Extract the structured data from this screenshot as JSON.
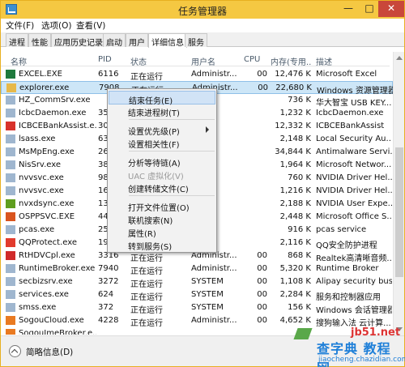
{
  "window": {
    "title": "任务管理器",
    "controls": {
      "minimize": "—",
      "maximize": "□",
      "close": "✕"
    }
  },
  "menu": [
    "文件(F)",
    "选项(O)",
    "查看(V)"
  ],
  "tabs": [
    "进程",
    "性能",
    "应用历史记录",
    "启动",
    "用户",
    "详细信息",
    "服务"
  ],
  "active_tab": "详细信息",
  "columns": [
    "名称",
    "PID",
    "状态",
    "用户名",
    "CPU",
    "内存(专用...",
    "描述"
  ],
  "processes": [
    {
      "name": "EXCEL.EXE",
      "pid": "6116",
      "status": "正在运行",
      "user": "Administr...",
      "cpu": "00",
      "mem": "12,476 K",
      "desc": "Microsoft Excel",
      "icon": "excel-icon"
    },
    {
      "name": "explorer.exe",
      "pid": "7908",
      "status": "正在运行",
      "user": "Administr...",
      "cpu": "00",
      "mem": "22,680 K",
      "desc": "Windows 资源管理器",
      "icon": "folder-icon",
      "selected": true
    },
    {
      "name": "HZ_CommSrv.exe",
      "pid": "",
      "status": "",
      "user": "",
      "cpu": "",
      "mem": "736 K",
      "desc": "华大智宝 USB KEY...",
      "icon": "generic-app-icon"
    },
    {
      "name": "IcbcDaemon.exe",
      "pid": "35",
      "status": "",
      "user": "",
      "cpu": "",
      "mem": "1,232 K",
      "desc": "IcbcDaemon.exe",
      "icon": "generic-app-icon"
    },
    {
      "name": "ICBCEBankAssist.e...",
      "pid": "30",
      "status": "",
      "user": "",
      "cpu": "",
      "mem": "12,332 K",
      "desc": "ICBCEBankAssist",
      "icon": "icbc-icon"
    },
    {
      "name": "lsass.exe",
      "pid": "63",
      "status": "",
      "user": "",
      "cpu": "",
      "mem": "2,148 K",
      "desc": "Local Security Au...",
      "icon": "generic-app-icon"
    },
    {
      "name": "MsMpEng.exe",
      "pid": "26",
      "status": "",
      "user": "",
      "cpu": "",
      "mem": "34,844 K",
      "desc": "Antimalware Servi...",
      "icon": "generic-app-icon"
    },
    {
      "name": "NisSrv.exe",
      "pid": "38",
      "status": "",
      "user": "",
      "cpu": "",
      "mem": "1,964 K",
      "desc": "Microsoft Networ...",
      "icon": "generic-app-icon"
    },
    {
      "name": "nvvsvc.exe",
      "pid": "98",
      "status": "",
      "user": "",
      "cpu": "",
      "mem": "760 K",
      "desc": "NVIDIA Driver Hel...",
      "icon": "generic-app-icon"
    },
    {
      "name": "nvvsvc.exe",
      "pid": "16",
      "status": "",
      "user": "",
      "cpu": "",
      "mem": "1,216 K",
      "desc": "NVIDIA Driver Hel...",
      "icon": "generic-app-icon"
    },
    {
      "name": "nvxdsync.exe",
      "pid": "13",
      "status": "",
      "user": "",
      "cpu": "",
      "mem": "2,188 K",
      "desc": "NVIDIA User Expe...",
      "icon": "nvidia-icon"
    },
    {
      "name": "OSPPSVC.EXE",
      "pid": "44",
      "status": "",
      "user": "",
      "cpu": "",
      "mem": "2,448 K",
      "desc": "Microsoft Office S...",
      "icon": "office-icon"
    },
    {
      "name": "pcas.exe",
      "pid": "25",
      "status": "",
      "user": "",
      "cpu": "",
      "mem": "916 K",
      "desc": "pcas service",
      "icon": "generic-app-icon"
    },
    {
      "name": "QQProtect.exe",
      "pid": "19",
      "status": "",
      "user": "",
      "cpu": "",
      "mem": "2,116 K",
      "desc": "QQ安全防护进程",
      "icon": "qq-icon"
    },
    {
      "name": "RtHDVCpl.exe",
      "pid": "3316",
      "status": "正在运行",
      "user": "Administr...",
      "cpu": "00",
      "mem": "868 K",
      "desc": "Realtek高清晰音频...",
      "icon": "speaker-icon"
    },
    {
      "name": "RuntimeBroker.exe",
      "pid": "7940",
      "status": "正在运行",
      "user": "Administr...",
      "cpu": "00",
      "mem": "5,320 K",
      "desc": "Runtime Broker",
      "icon": "generic-app-icon"
    },
    {
      "name": "secbizsrv.exe",
      "pid": "3272",
      "status": "正在运行",
      "user": "SYSTEM",
      "cpu": "00",
      "mem": "1,108 K",
      "desc": "Alipay security bus...",
      "icon": "generic-app-icon"
    },
    {
      "name": "services.exe",
      "pid": "624",
      "status": "正在运行",
      "user": "SYSTEM",
      "cpu": "00",
      "mem": "2,284 K",
      "desc": "服务和控制器应用",
      "icon": "generic-app-icon"
    },
    {
      "name": "smss.exe",
      "pid": "372",
      "status": "正在运行",
      "user": "SYSTEM",
      "cpu": "00",
      "mem": "156 K",
      "desc": "Windows 会话管理器",
      "icon": "generic-app-icon"
    },
    {
      "name": "SogouCloud.exe",
      "pid": "4228",
      "status": "正在运行",
      "user": "Administr...",
      "cpu": "00",
      "mem": "4,652 K",
      "desc": "搜狗输入法 云计算...",
      "icon": "sogou-icon"
    },
    {
      "name": "SogouImeBroker.e...",
      "pid": "",
      "status": "",
      "user": "",
      "cpu": "",
      "mem": "",
      "desc": "",
      "icon": "sogou-icon"
    }
  ],
  "context_menu": [
    {
      "label": "结束任务(E)",
      "hover": true
    },
    {
      "label": "结束进程树(T)"
    },
    {
      "sep": true
    },
    {
      "label": "设置优先级(P)",
      "submenu": true
    },
    {
      "label": "设置相关性(F)"
    },
    {
      "sep": true
    },
    {
      "label": "分析等待链(A)"
    },
    {
      "label": "UAC 虚拟化(V)",
      "disabled": true
    },
    {
      "label": "创建转储文件(C)"
    },
    {
      "sep": true
    },
    {
      "label": "打开文件位置(O)"
    },
    {
      "label": "联机搜索(N)"
    },
    {
      "label": "属性(R)"
    },
    {
      "label": "转到服务(S)"
    }
  ],
  "footer": {
    "label": "简略信息(D)"
  },
  "watermark": {
    "site": "jb51.net",
    "text": "查字典 教程网",
    "sub": "jiaocheng.chazidian.com"
  },
  "icon_colors": {
    "excel-icon": "#1f7a3d",
    "folder-icon": "#e7b94a",
    "generic-app-icon": "#9fb6cf",
    "icbc-icon": "#d8322b",
    "nvidia-icon": "#5f9e1f",
    "office-icon": "#d9541e",
    "qq-icon": "#e23b2d",
    "speaker-icon": "#d02a2a",
    "sogou-icon": "#e97a21"
  }
}
